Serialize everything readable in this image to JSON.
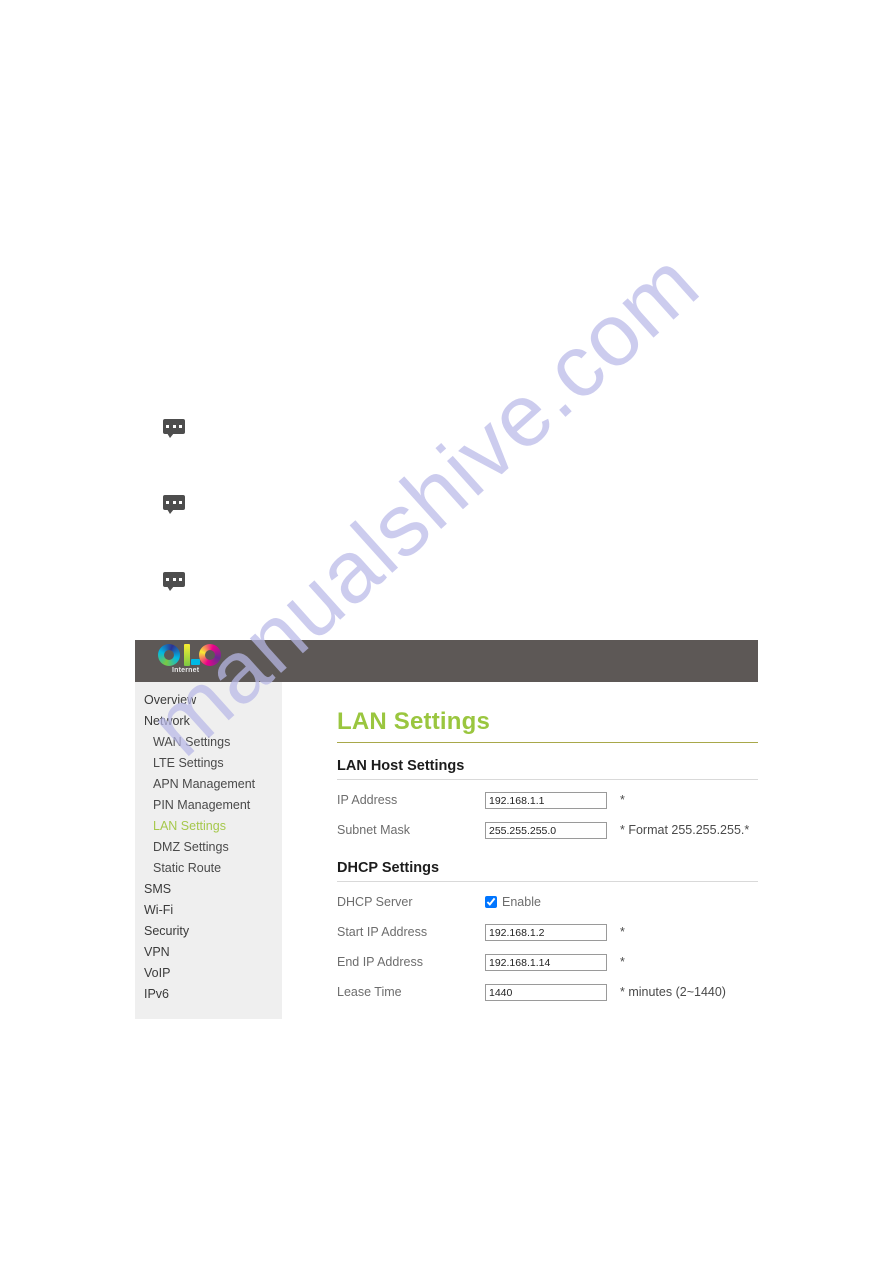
{
  "page": {
    "watermark_text": "manualshive.com",
    "watermark_color": "#b9b9e8",
    "note_icon_name": "note-bubble-icon"
  },
  "router_ui": {
    "brand": {
      "logo_text": "OLO",
      "logo_subtitle": "Internet",
      "header_color": "#5d5856"
    },
    "sidebar": {
      "items": [
        {
          "label": "Overview",
          "level": 1,
          "active": false
        },
        {
          "label": "Network",
          "level": 1,
          "active": false
        },
        {
          "label": "WAN Settings",
          "level": 2,
          "active": false
        },
        {
          "label": "LTE Settings",
          "level": 2,
          "active": false
        },
        {
          "label": "APN Management",
          "level": 2,
          "active": false
        },
        {
          "label": "PIN Management",
          "level": 2,
          "active": false
        },
        {
          "label": "LAN Settings",
          "level": 2,
          "active": true
        },
        {
          "label": "DMZ Settings",
          "level": 2,
          "active": false
        },
        {
          "label": "Static Route",
          "level": 2,
          "active": false
        },
        {
          "label": "SMS",
          "level": 1,
          "active": false
        },
        {
          "label": "Wi-Fi",
          "level": 1,
          "active": false
        },
        {
          "label": "Security",
          "level": 1,
          "active": false
        },
        {
          "label": "VPN",
          "level": 1,
          "active": false
        },
        {
          "label": "VoIP",
          "level": 1,
          "active": false
        },
        {
          "label": "IPv6",
          "level": 1,
          "active": false
        }
      ],
      "active_color": "#a6c84c"
    },
    "content": {
      "page_title": "LAN Settings",
      "page_title_color": "#9ac63f",
      "sections": [
        {
          "heading": "LAN Host Settings",
          "rows": [
            {
              "label": "IP Address",
              "value": "192.168.1.1",
              "hint": "*"
            },
            {
              "label": "Subnet Mask",
              "value": "255.255.255.0",
              "hint": "*  Format 255.255.255.*"
            }
          ]
        },
        {
          "heading": "DHCP Settings",
          "rows": [
            {
              "label": "DHCP Server",
              "type": "checkbox",
              "checkbox_label": "Enable",
              "checked": true,
              "hint": ""
            },
            {
              "label": "Start IP Address",
              "value": "192.168.1.2",
              "hint": "*"
            },
            {
              "label": "End IP Address",
              "value": "192.168.1.14",
              "hint": "*"
            },
            {
              "label": "Lease Time",
              "value": "1440",
              "hint": "*  minutes (2~1440)"
            }
          ]
        }
      ]
    }
  }
}
